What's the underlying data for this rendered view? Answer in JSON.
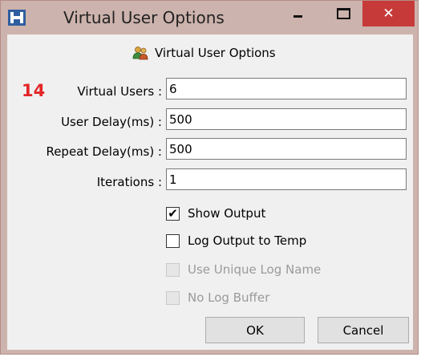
{
  "window": {
    "title": "Virtual User Options",
    "close_glyph": "✕"
  },
  "header": {
    "icon": "users-icon",
    "label": "Virtual User Options"
  },
  "badge": "14",
  "fields": {
    "virtual_users": {
      "label": "Virtual Users :",
      "value": "6"
    },
    "user_delay": {
      "label": "User Delay(ms) :",
      "value": "500"
    },
    "repeat_delay": {
      "label": "Repeat Delay(ms) :",
      "value": "500"
    },
    "iterations": {
      "label": "Iterations :",
      "value": "1"
    }
  },
  "checkboxes": {
    "show_output": {
      "label": "Show Output",
      "checked": true,
      "enabled": true,
      "mark": "✔"
    },
    "log_output_temp": {
      "label": "Log Output to Temp",
      "checked": false,
      "enabled": true
    },
    "unique_log_name": {
      "label": "Use Unique Log Name",
      "checked": false,
      "enabled": false
    },
    "no_log_buffer": {
      "label": "No Log Buffer",
      "checked": false,
      "enabled": false
    }
  },
  "buttons": {
    "ok": "OK",
    "cancel": "Cancel"
  },
  "colors": {
    "titlebar": "#cdb3ad",
    "close": "#c73a3a",
    "badge": "#e32626",
    "app_icon": "#2d5fa0"
  }
}
